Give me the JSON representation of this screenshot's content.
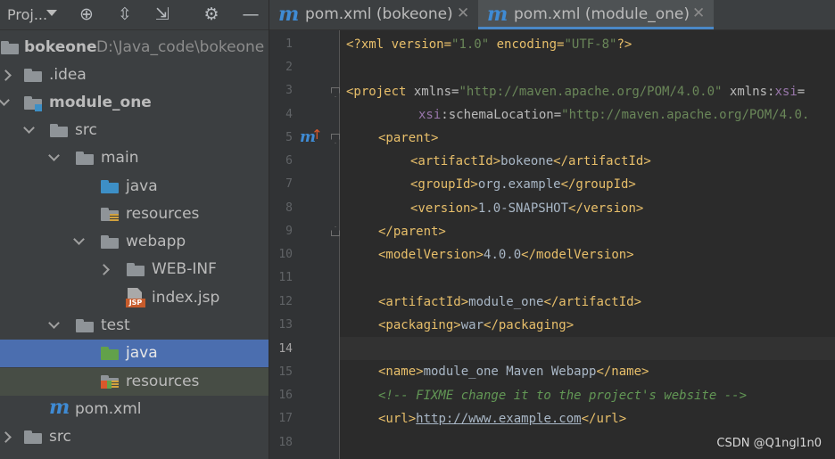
{
  "project_panel": {
    "title": "Proj...",
    "tree": [
      {
        "label": "bokeone",
        "sub": "D:\\Java_code\\bokeone",
        "bold": true
      },
      {
        "label": ".idea"
      },
      {
        "label": "module_one",
        "bold": true
      },
      {
        "label": "src"
      },
      {
        "label": "main"
      },
      {
        "label": "java"
      },
      {
        "label": "resources"
      },
      {
        "label": "webapp"
      },
      {
        "label": "WEB-INF"
      },
      {
        "label": "index.jsp"
      },
      {
        "label": "test"
      },
      {
        "label": "java"
      },
      {
        "label": "resources"
      },
      {
        "label": "pom.xml"
      },
      {
        "label": "src"
      }
    ]
  },
  "editor": {
    "tabs": [
      {
        "label": "pom.xml (bokeone)",
        "active": false
      },
      {
        "label": "pom.xml (module_one)",
        "active": true
      }
    ],
    "line_numbers": [
      "1",
      "2",
      "3",
      "4",
      "5",
      "6",
      "7",
      "8",
      "9",
      "10",
      "11",
      "12",
      "13",
      "14",
      "15",
      "16",
      "17",
      "18"
    ],
    "current_line": "14"
  },
  "code": {
    "l1": {
      "p1": "<?xml version=",
      "p2": "\"1.0\"",
      "p3": " encoding=",
      "p4": "\"UTF-8\"",
      "p5": "?>"
    },
    "l3": {
      "tag": "<project",
      "a1": " xmlns=",
      "v1": "\"http://maven.apache.org/POM/4.0.0\"",
      "a2": " xmlns:",
      "ns": "xsi",
      "a3": "="
    },
    "l4": {
      "ns": "xsi",
      "a": ":schemaLocation=",
      "v": "\"http://maven.apache.org/POM/4.0."
    },
    "l5": "<parent>",
    "l6": {
      "o": "<artifactId>",
      "t": "bokeone",
      "c": "</artifactId>"
    },
    "l7": {
      "o": "<groupId>",
      "t": "org.example",
      "c": "</groupId>"
    },
    "l8": {
      "o": "<version>",
      "t": "1.0-SNAPSHOT",
      "c": "</version>"
    },
    "l9": "</parent>",
    "l10": {
      "o": "<modelVersion>",
      "t": "4.0.0",
      "c": "</modelVersion>"
    },
    "l12": {
      "o": "<artifactId>",
      "t": "module_one",
      "c": "</artifactId>"
    },
    "l13": {
      "o": "<packaging>",
      "t": "war",
      "c": "</packaging>"
    },
    "l15": {
      "o": "<name>",
      "t": "module_one Maven Webapp",
      "c": "</name>"
    },
    "l16": "<!-- FIXME change it to the project's website -->",
    "l17": {
      "o": "<url>",
      "t": "http://www.example.com",
      "c": "</url>"
    }
  },
  "watermark": "CSDN @Q1ngl1n0",
  "colors": {
    "selection": "#4b6eaf",
    "folder": "#8f9498",
    "source_folder": "#3d8fc6",
    "test_folder": "#62a14a",
    "tag": "#e8bf6a",
    "string": "#6a8759"
  }
}
